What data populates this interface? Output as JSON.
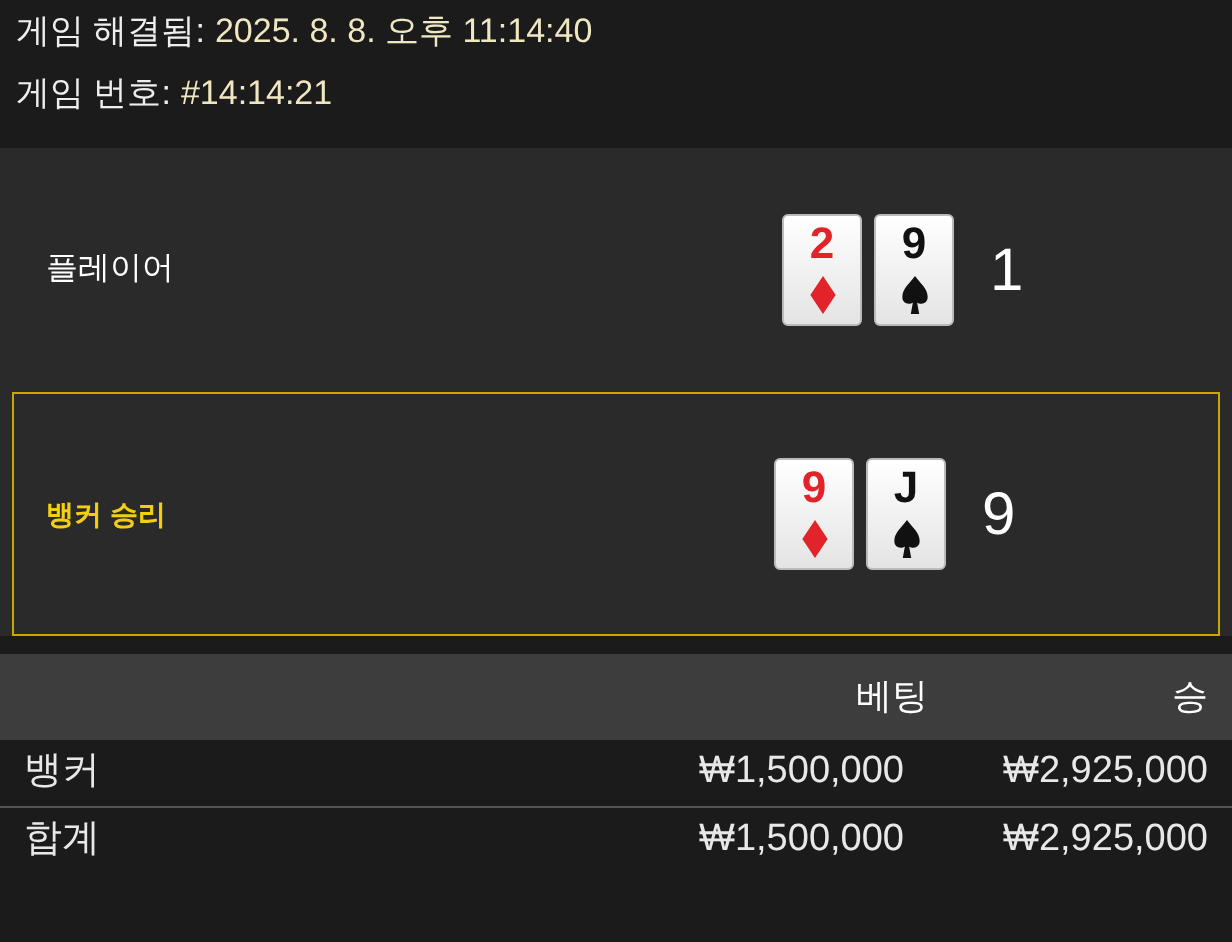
{
  "info": [
    {
      "label": "게임 해결됨:",
      "value": "2025. 8. 8. 오후 11:14:40"
    },
    {
      "label": "게임 번호:",
      "value": "#14:14:21"
    }
  ],
  "hands": [
    {
      "label": "플레이어",
      "winner": false,
      "cards": [
        {
          "rank": "2",
          "kind": "diamond"
        },
        {
          "rank": "9",
          "kind": "spade"
        }
      ],
      "score": "1"
    },
    {
      "label": "뱅커 승리",
      "winner": true,
      "cards": [
        {
          "rank": "9",
          "kind": "diamond"
        },
        {
          "rank": "J",
          "kind": "spade"
        }
      ],
      "score": "9"
    }
  ],
  "table": {
    "columns": [
      "베팅",
      "승"
    ],
    "rows": [
      {
        "label": "뱅커",
        "bet": "₩1,500,000",
        "win": "₩2,925,000"
      },
      {
        "label": "합계",
        "bet": "₩1,500,000",
        "win": "₩2,925,000"
      }
    ]
  }
}
